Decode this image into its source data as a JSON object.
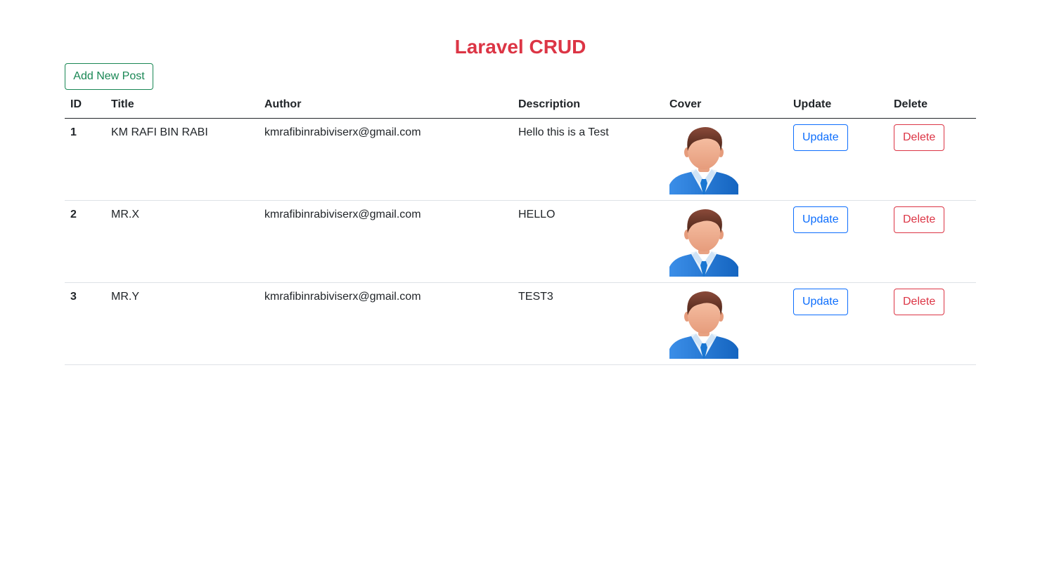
{
  "page": {
    "title": "Laravel CRUD",
    "add_button": "Add New Post"
  },
  "table": {
    "headers": [
      "ID",
      "Title",
      "Author",
      "Description",
      "Cover",
      "Update",
      "Delete"
    ],
    "rows": [
      {
        "id": "1",
        "title": "KM RAFI BIN RABI",
        "author": "kmrafibinrabiviserx@gmail.com",
        "description": "Hello this is a Test",
        "cover": "person-avatar-icon",
        "update": "Update",
        "delete": "Delete"
      },
      {
        "id": "2",
        "title": "MR.X",
        "author": "kmrafibinrabiviserx@gmail.com",
        "description": "HELLO",
        "cover": "person-avatar-icon",
        "update": "Update",
        "delete": "Delete"
      },
      {
        "id": "3",
        "title": "MR.Y",
        "author": "kmrafibinrabiviserx@gmail.com",
        "description": "TEST3",
        "cover": "person-avatar-icon",
        "update": "Update",
        "delete": "Delete"
      }
    ]
  },
  "colors": {
    "title": "#dc3545",
    "success": "#198754",
    "primary": "#0d6efd",
    "danger": "#dc3545"
  }
}
